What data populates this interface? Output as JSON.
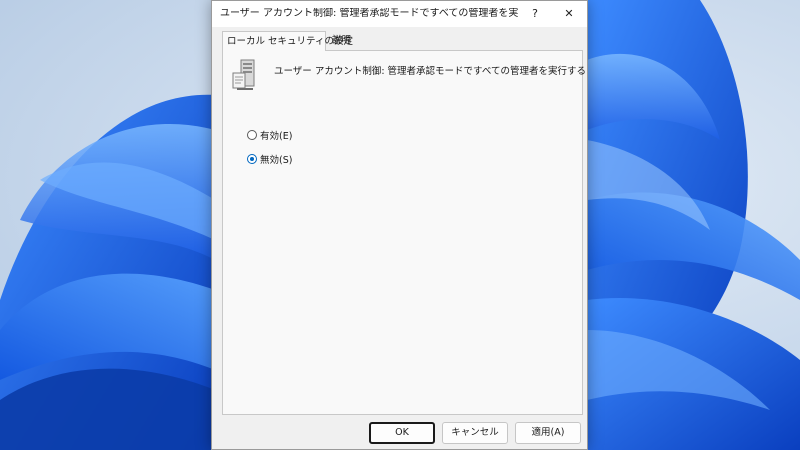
{
  "window": {
    "title": "ユーザー アカウント制御: 管理者承認モードですべての管理者を実行するのプロ...",
    "help_label": "?",
    "close_label": "✕"
  },
  "tabs": [
    {
      "label": "ローカル セキュリティの設定",
      "selected": true
    },
    {
      "label": "説明",
      "selected": false
    }
  ],
  "policy": {
    "icon": "server-policy-icon",
    "name": "ユーザー アカウント制御: 管理者承認モードですべての管理者を実行する"
  },
  "options": [
    {
      "label": "有効(E)",
      "checked": false
    },
    {
      "label": "無効(S)",
      "checked": true
    }
  ],
  "buttons": {
    "ok": "OK",
    "cancel": "キャンセル",
    "apply": "適用(A)"
  },
  "colors": {
    "accent": "#0067c0",
    "wallpaper_blue": "#1a63e0"
  }
}
